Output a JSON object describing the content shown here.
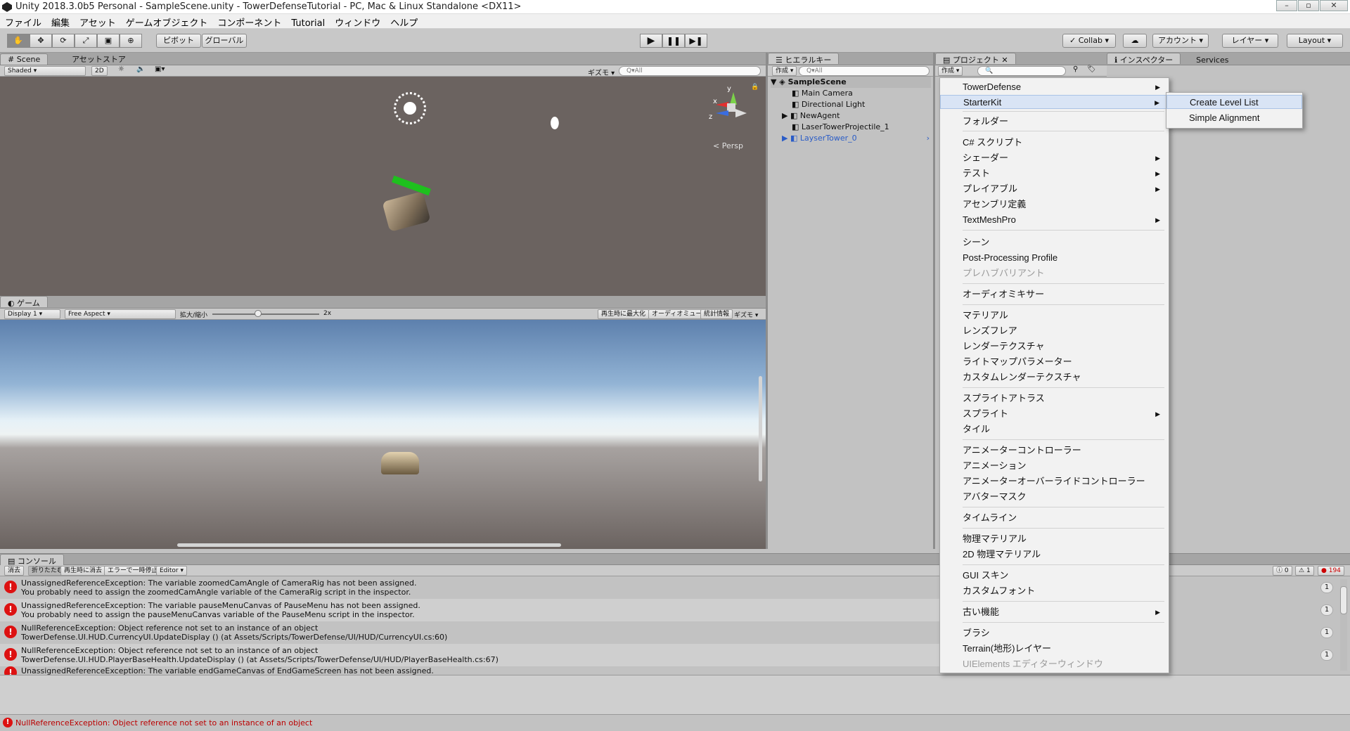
{
  "window": {
    "title": "Unity 2018.3.0b5 Personal - SampleScene.unity - TowerDefenseTutorial - PC, Mac & Linux Standalone <DX11>"
  },
  "menubar": [
    "ファイル",
    "編集",
    "アセット",
    "ゲームオブジェクト",
    "コンポーネント",
    "Tutorial",
    "ウィンドウ",
    "ヘルプ"
  ],
  "toolbar": {
    "pivot": "ピボット",
    "global": "グローバル",
    "collab": "Collab",
    "account": "アカウント",
    "layers": "レイヤー",
    "layout": "Layout"
  },
  "scene": {
    "tab_scene": "Scene",
    "tab_asset_store": "アセットストア",
    "shading": "Shaded",
    "mode_2d": "2D",
    "gizmos": "ギズモ",
    "search_placeholder": "Q▾All",
    "persp": "< Persp",
    "axis_x": "x",
    "axis_y": "y",
    "axis_z": "z"
  },
  "game": {
    "tab": "ゲーム",
    "display": "Display 1",
    "aspect": "Free Aspect",
    "scale_label": "拡大/縮小",
    "scale_value": "2x",
    "buttons": [
      "再生時に最大化",
      "オーディオミュート",
      "統計情報",
      "ギズモ"
    ]
  },
  "hierarchy": {
    "tab": "ヒエラルキー",
    "create": "作成",
    "search_placeholder": "Q▾All",
    "scene_name": "SampleScene",
    "items": [
      "Main Camera",
      "Directional Light",
      "NewAgent",
      "LaserTowerProjectile_1",
      "LayserTower_0"
    ]
  },
  "project": {
    "tab": "プロジェクト",
    "create": "作成"
  },
  "inspector": {
    "tab": "インスペクター",
    "services": "Services"
  },
  "context_menu": {
    "items": [
      {
        "label": "TowerDefense",
        "sub": true
      },
      {
        "label": "StarterKit",
        "sub": true,
        "highlight": true
      },
      {
        "label": "フォルダー"
      },
      {
        "label": "C# スクリプト"
      },
      {
        "label": "シェーダー",
        "sub": true
      },
      {
        "label": "テスト",
        "sub": true
      },
      {
        "label": "プレイアブル",
        "sub": true
      },
      {
        "label": "アセンブリ定義"
      },
      {
        "label": "TextMeshPro",
        "sub": true
      },
      {
        "label": "シーン"
      },
      {
        "label": "Post-Processing Profile"
      },
      {
        "label": "プレハブバリアント",
        "disabled": true
      },
      {
        "label": "オーディオミキサー"
      },
      {
        "label": "マテリアル"
      },
      {
        "label": "レンズフレア"
      },
      {
        "label": "レンダーテクスチャ"
      },
      {
        "label": "ライトマップパラメーター"
      },
      {
        "label": "カスタムレンダーテクスチャ"
      },
      {
        "label": "スプライトアトラス"
      },
      {
        "label": "スプライト",
        "sub": true
      },
      {
        "label": "タイル"
      },
      {
        "label": "アニメーターコントローラー"
      },
      {
        "label": "アニメーション"
      },
      {
        "label": "アニメーターオーバーライドコントローラー"
      },
      {
        "label": "アバターマスク"
      },
      {
        "label": "タイムライン"
      },
      {
        "label": "物理マテリアル"
      },
      {
        "label": "2D 物理マテリアル"
      },
      {
        "label": "GUI スキン"
      },
      {
        "label": "カスタムフォント"
      },
      {
        "label": "古い機能",
        "sub": true
      },
      {
        "label": "ブラシ"
      },
      {
        "label": "Terrain(地形)レイヤー"
      },
      {
        "label": "UIElements エディターウィンドウ",
        "disabled": true
      }
    ],
    "submenu": [
      "Create Level List",
      "Simple Alignment"
    ]
  },
  "console": {
    "tab": "コンソール",
    "buttons": [
      "消去",
      "折りたたむ",
      "再生時に消去",
      "エラーで一時停止",
      "Editor"
    ],
    "counts": {
      "info": "0",
      "warn": "1",
      "error": "194"
    },
    "rows": [
      {
        "l1": "UnassignedReferenceException: The variable zoomedCamAngle of CameraRig has not been assigned.",
        "l2": "You probably need to assign the zoomedCamAngle variable of the CameraRig script in the inspector.",
        "count": "1"
      },
      {
        "l1": "UnassignedReferenceException: The variable pauseMenuCanvas of PauseMenu has not been assigned.",
        "l2": "You probably need to assign the pauseMenuCanvas variable of the PauseMenu script in the inspector.",
        "count": "1"
      },
      {
        "l1": "NullReferenceException: Object reference not set to an instance of an object",
        "l2": "TowerDefense.UI.HUD.CurrencyUI.UpdateDisplay () (at Assets/Scripts/TowerDefense/UI/HUD/CurrencyUI.cs:60)",
        "count": "1"
      },
      {
        "l1": "NullReferenceException: Object reference not set to an instance of an object",
        "l2": "TowerDefense.UI.HUD.PlayerBaseHealth.UpdateDisplay () (at Assets/Scripts/TowerDefense/UI/HUD/PlayerBaseHealth.cs:67)",
        "count": "1"
      },
      {
        "l1": "UnassignedReferenceException: The variable endGameCanvas of EndGameScreen has not been assigned.",
        "l2": "",
        "count": "1"
      }
    ]
  },
  "statusbar": {
    "text": "NullReferenceException: Object reference not set to an instance of an object"
  },
  "colors": {
    "error": "#d11111",
    "menu_highlight": "#d9e4f5",
    "prefab_blue": "#2a5cc7"
  }
}
